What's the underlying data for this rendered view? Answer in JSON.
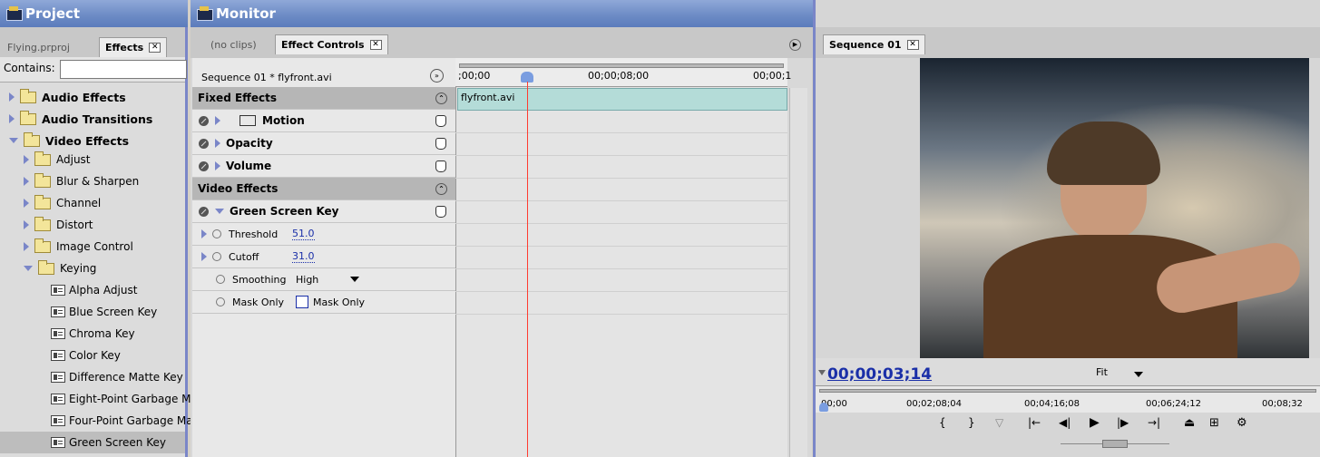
{
  "project_panel": {
    "title": "Project",
    "tabs": [
      {
        "label": "Flying.prproj"
      },
      {
        "label": "Effects"
      }
    ],
    "contains_label": "Contains:",
    "contains_value": "",
    "tree": [
      {
        "label": "Audio Effects"
      },
      {
        "label": "Audio Transitions"
      },
      {
        "label": "Video Effects"
      },
      {
        "label": "Adjust"
      },
      {
        "label": "Blur & Sharpen"
      },
      {
        "label": "Channel"
      },
      {
        "label": "Distort"
      },
      {
        "label": "Image Control"
      },
      {
        "label": "Keying"
      },
      {
        "label": "Alpha Adjust"
      },
      {
        "label": "Blue Screen Key"
      },
      {
        "label": "Chroma Key"
      },
      {
        "label": "Color Key"
      },
      {
        "label": "Difference Matte Key"
      },
      {
        "label": "Eight-Point Garbage M"
      },
      {
        "label": "Four-Point Garbage Ma"
      },
      {
        "label": "Green Screen Key"
      }
    ]
  },
  "monitor_panel": {
    "title": "Monitor",
    "tabs": [
      {
        "label": "(no clips)"
      },
      {
        "label": "Effect Controls"
      }
    ],
    "clip_path": "Sequence 01 * flyfront.avi",
    "ruler": {
      "t0": ";00;00",
      "t1": "00;00;08;00",
      "t2": "00;00;1"
    },
    "clip_name": "flyfront.avi",
    "sections": {
      "fixed": "Fixed Effects",
      "motion": "Motion",
      "opacity": "Opacity",
      "volume": "Volume",
      "video": "Video Effects",
      "green_screen": "Green Screen Key"
    },
    "params": {
      "threshold_label": "Threshold",
      "threshold_value": "51.0",
      "cutoff_label": "Cutoff",
      "cutoff_value": "31.0",
      "smoothing_label": "Smoothing",
      "smoothing_value": "High",
      "mask_only_label": "Mask Only",
      "mask_only_checkbox": "Mask Only"
    }
  },
  "program_panel": {
    "tab": "Sequence 01",
    "timecode": "00;00;03;14",
    "fit": "Fit",
    "ruler": [
      "00;00",
      "00;02;08;04",
      "00;04;16;08",
      "00;06;24;12",
      "00;08;32"
    ]
  }
}
